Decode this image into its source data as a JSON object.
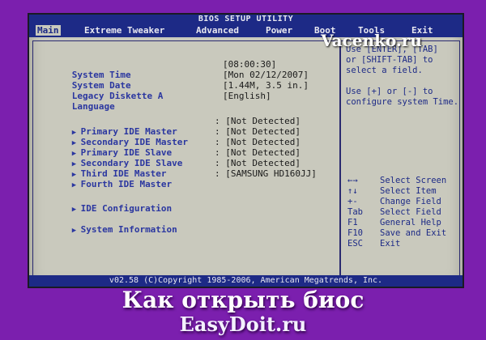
{
  "bios": {
    "title": "BIOS SETUP UTILITY",
    "menu": [
      "Main",
      "Extreme Tweaker",
      "Advanced",
      "Power",
      "Boot",
      "Tools",
      "Exit"
    ],
    "active_menu": "Main",
    "fields": [
      {
        "label": "System Time",
        "value": "[08:00:30]"
      },
      {
        "label": "System Date",
        "value": "[Mon 02/12/2007]"
      },
      {
        "label": "Legacy Diskette A",
        "value": "[1.44M, 3.5 in.]"
      },
      {
        "label": "Language",
        "value": "[English]"
      }
    ],
    "ide_items": [
      {
        "label": "Primary IDE Master",
        "value": "[Not Detected]"
      },
      {
        "label": "Secondary IDE Master",
        "value": "[Not Detected]"
      },
      {
        "label": "Primary IDE Slave",
        "value": "[Not Detected]"
      },
      {
        "label": "Secondary IDE Slave",
        "value": "[Not Detected]"
      },
      {
        "label": "Third IDE Master",
        "value": "[Not Detected]"
      },
      {
        "label": "Fourth IDE Master",
        "value": "[SAMSUNG HD160JJ]"
      }
    ],
    "submenus": [
      "IDE Configuration",
      "System Information"
    ],
    "help_lines": [
      "Use [ENTER], [TAB]",
      "or [SHIFT-TAB] to",
      "select a field.",
      "",
      "Use [+] or [-] to",
      "configure system Time."
    ],
    "keys": [
      {
        "key": "←→",
        "desc": "Select Screen"
      },
      {
        "key": "↑↓",
        "desc": "Select Item"
      },
      {
        "key": "+-",
        "desc": "Change Field"
      },
      {
        "key": "Tab",
        "desc": "Select Field"
      },
      {
        "key": "F1",
        "desc": "General Help"
      },
      {
        "key": "F10",
        "desc": "Save and Exit"
      },
      {
        "key": "ESC",
        "desc": "Exit"
      }
    ],
    "footer": "v02.58 (C)Copyright 1985-2006, American Megatrends, Inc."
  },
  "watermark": "Vacenko.ru",
  "caption": "Как открыть биос",
  "caption2": "EasyDoit.ru"
}
